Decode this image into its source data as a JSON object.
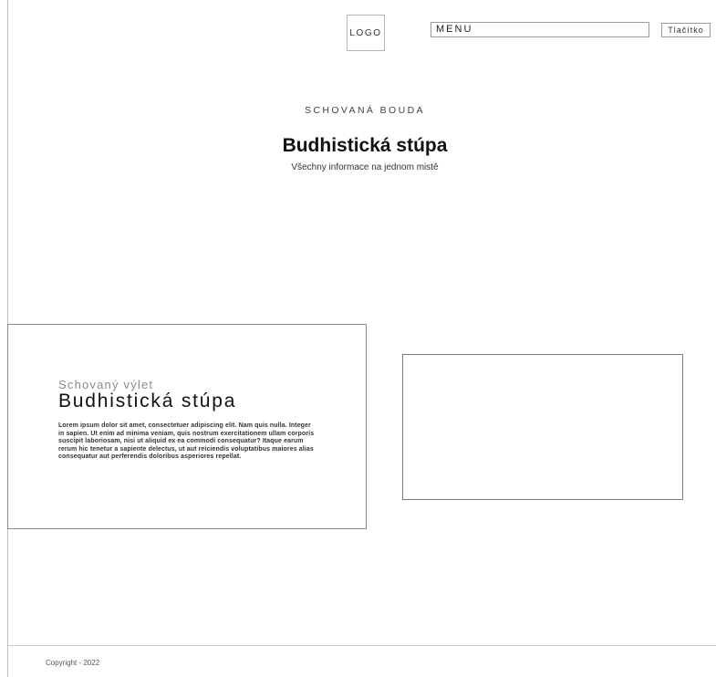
{
  "header": {
    "logo_text": "LOGO",
    "menu_label": "MENU",
    "button_label": "Tlačítko"
  },
  "hero": {
    "kicker": "SCHOVANÁ BOUDA",
    "title": "Budhistická stúpa",
    "subtitle": "Všechny informace na jednom mistě"
  },
  "card": {
    "kicker": "Schovaný výlet",
    "title": "Budhistická stúpa",
    "body": "Lorem ipsum dolor sit amet, consectetuer adipiscing elit. Nam quis nulla. Integer in sapien. Ut enim ad minima veniam, quis nostrum exercitationem ullam corporis suscipit laboriosam, nisi ut aliquid ex ea commodi consequatur? Itaque earum rerum hic tenetur a sapiente delectus, ut aut reiciendis voluptatibus maiores alias consequatur aut perferendis doloribus asperiores repellat."
  },
  "footer": {
    "copyright": "Copyright - 2022"
  }
}
